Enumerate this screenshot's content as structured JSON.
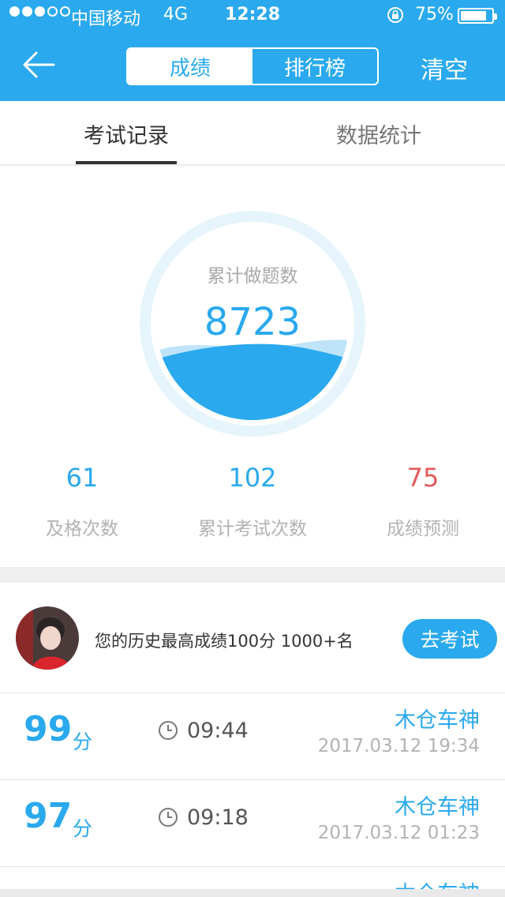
{
  "status_bar": {
    "carrier": "中国移动",
    "network": "4G",
    "time": "12:28",
    "battery_percent": "75%",
    "signal_level": 3,
    "signal_max": 5
  },
  "nav": {
    "segments": [
      {
        "label": "成绩",
        "active": true
      },
      {
        "label": "排行榜",
        "active": false
      }
    ],
    "clear_label": "清空"
  },
  "tabs": [
    {
      "label": "考试记录",
      "active": true
    },
    {
      "label": "数据统计",
      "active": false
    }
  ],
  "summary": {
    "ring_label": "累计做题数",
    "total_questions": "8723",
    "stats": [
      {
        "value": "61",
        "label": "及格次数",
        "color": "#2aa9ee"
      },
      {
        "value": "102",
        "label": "累计考试次数",
        "color": "#2aa9ee"
      },
      {
        "value": "75",
        "label": "成绩预测",
        "color": "#e45a5a"
      }
    ]
  },
  "best": {
    "text": "您的历史最高成绩100分  1000+名",
    "button_label": "去考试"
  },
  "records": [
    {
      "score": "99",
      "unit": "分",
      "duration": "09:44",
      "name": "木仓车神",
      "date": "2017.03.12 19:34"
    },
    {
      "score": "97",
      "unit": "分",
      "duration": "09:18",
      "name": "木仓车神",
      "date": "2017.03.12 01:23"
    },
    {
      "name": "木仓车神"
    }
  ],
  "colors": {
    "accent": "#2aa9ee",
    "warning": "#e45a5a",
    "muted": "#b3b3b3"
  }
}
